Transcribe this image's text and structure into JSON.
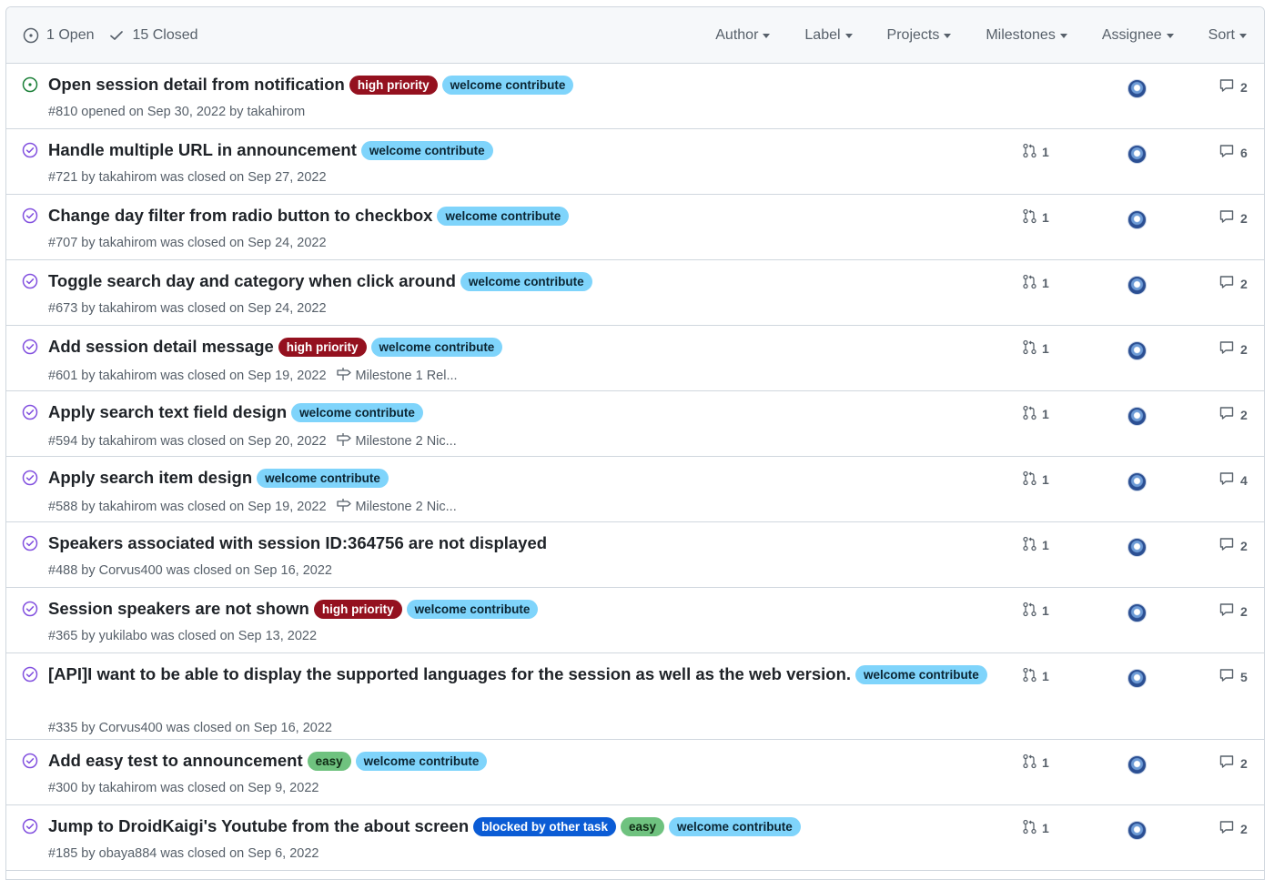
{
  "header": {
    "open_label": "1 Open",
    "closed_label": "15 Closed",
    "filters": [
      "Author",
      "Label",
      "Projects",
      "Milestones",
      "Assignee",
      "Sort"
    ]
  },
  "colors": {
    "open_icon": "#1a7f37",
    "closed_icon": "#8250df",
    "label_high_priority_bg": "#94111f",
    "label_welcome_bg": "#7fd4fb",
    "label_easy_bg": "#6fc27f",
    "label_blocked_bg": "#0b5cd5"
  },
  "issues": [
    {
      "state": "open",
      "title": "Open session detail from notification",
      "labels": [
        "high priority",
        "welcome contribute"
      ],
      "meta": "#810 opened on Sep 30, 2022 by takahirom",
      "milestone": "",
      "prs": "",
      "comments": "2"
    },
    {
      "state": "closed",
      "title": "Handle multiple URL in announcement",
      "labels": [
        "welcome contribute"
      ],
      "meta": "#721 by takahirom was closed on Sep 27, 2022",
      "milestone": "",
      "prs": "1",
      "comments": "6"
    },
    {
      "state": "closed",
      "title": "Change day filter from radio button to checkbox",
      "labels": [
        "welcome contribute"
      ],
      "meta": "#707 by takahirom was closed on Sep 24, 2022",
      "milestone": "",
      "prs": "1",
      "comments": "2"
    },
    {
      "state": "closed",
      "title": "Toggle search day and category when click around",
      "labels": [
        "welcome contribute"
      ],
      "meta": "#673 by takahirom was closed on Sep 24, 2022",
      "milestone": "",
      "prs": "1",
      "comments": "2"
    },
    {
      "state": "closed",
      "title": "Add session detail message",
      "labels": [
        "high priority",
        "welcome contribute"
      ],
      "meta": "#601 by takahirom was closed on Sep 19, 2022",
      "milestone": "Milestone 1 Rel...",
      "prs": "1",
      "comments": "2"
    },
    {
      "state": "closed",
      "title": "Apply search text field design",
      "labels": [
        "welcome contribute"
      ],
      "meta": "#594 by takahirom was closed on Sep 20, 2022",
      "milestone": "Milestone 2 Nic...",
      "prs": "1",
      "comments": "2"
    },
    {
      "state": "closed",
      "title": "Apply search item design",
      "labels": [
        "welcome contribute"
      ],
      "meta": "#588 by takahirom was closed on Sep 19, 2022",
      "milestone": "Milestone 2 Nic...",
      "prs": "1",
      "comments": "4"
    },
    {
      "state": "closed",
      "title": "Speakers associated with session ID:364756 are not displayed",
      "labels": [],
      "meta": "#488 by Corvus400 was closed on Sep 16, 2022",
      "milestone": "",
      "prs": "1",
      "comments": "2"
    },
    {
      "state": "closed",
      "title": "Session speakers are not shown",
      "labels": [
        "high priority",
        "welcome contribute"
      ],
      "meta": "#365 by yukilabo was closed on Sep 13, 2022",
      "milestone": "",
      "prs": "1",
      "comments": "2"
    },
    {
      "state": "closed",
      "title": "[API]I want to be able to display the supported languages for the session as well as the web version.",
      "labels": [
        "welcome contribute"
      ],
      "meta": "#335 by Corvus400 was closed on Sep 16, 2022",
      "milestone": "",
      "prs": "1",
      "comments": "5",
      "tall": true
    },
    {
      "state": "closed",
      "title": "Add easy test to announcement",
      "labels": [
        "easy",
        "welcome contribute"
      ],
      "meta": "#300 by takahirom was closed on Sep 9, 2022",
      "milestone": "",
      "prs": "1",
      "comments": "2"
    },
    {
      "state": "closed",
      "title": "Jump to DroidKaigi's Youtube from the about screen",
      "labels": [
        "blocked by other task",
        "easy",
        "welcome contribute"
      ],
      "meta": "#185 by obaya884 was closed on Sep 6, 2022",
      "milestone": "",
      "prs": "1",
      "comments": "2"
    }
  ]
}
